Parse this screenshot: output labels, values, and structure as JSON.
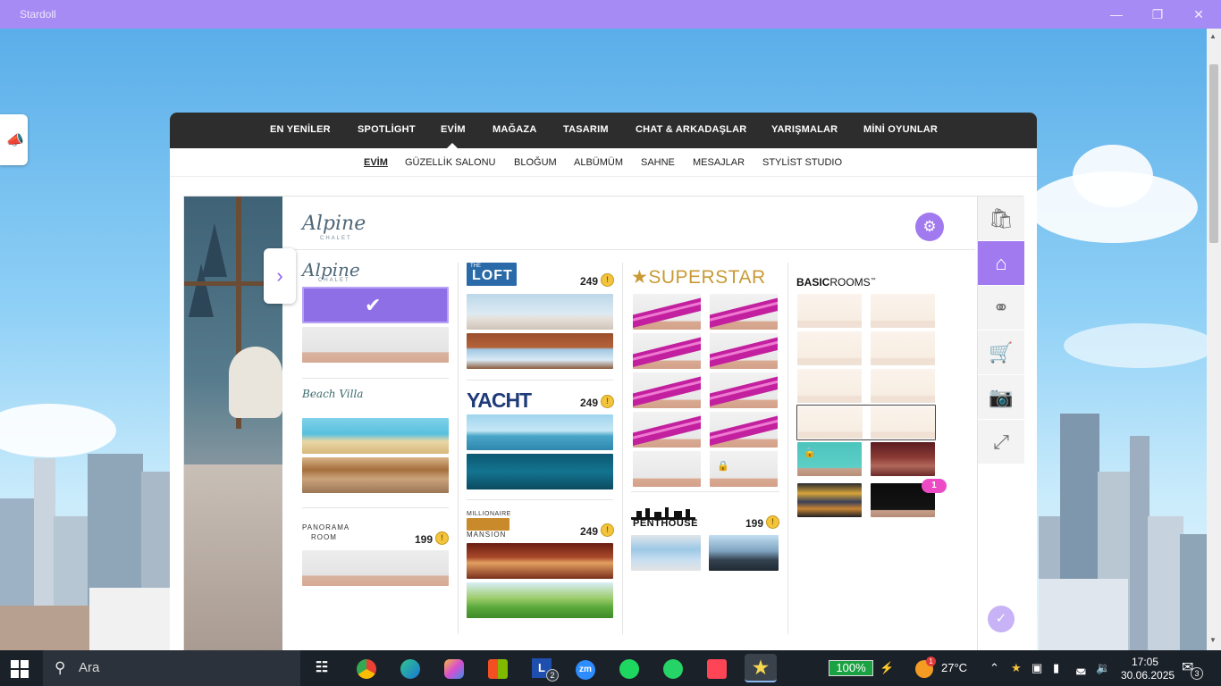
{
  "window": {
    "title": "Stardoll",
    "controls": [
      "minimize",
      "maximize",
      "close"
    ]
  },
  "top_nav": {
    "items": [
      "EN YENİLER",
      "SPOTLİGHT",
      "EVİM",
      "MAĞAZA",
      "TASARIM",
      "CHAT & ARKADAŞLAR",
      "YARIŞMALAR",
      "MİNİ OYUNLAR"
    ],
    "active": "EVİM"
  },
  "sub_nav": {
    "items": [
      "EVİM",
      "GÜZELLİK SALONU",
      "BLOĞUM",
      "ALBÜMÜM",
      "SAHNE",
      "MESAJLAR",
      "STYLİST STUDIO"
    ],
    "active": "EVİM"
  },
  "gallery": {
    "header_logo": {
      "script": "Alpine",
      "sub": "CHALET"
    },
    "alpine": {
      "script": "Alpine",
      "sub": "CHALET",
      "selected_room": 1
    },
    "beach_villa": {
      "script": "Beach Villa"
    },
    "panorama": {
      "line1": "PANORAMA",
      "line2": "ROOM",
      "price": "199"
    },
    "loft": {
      "label": "LOFT",
      "prefix": "THE",
      "price": "249"
    },
    "yacht": {
      "label": "YACHT",
      "price": "249"
    },
    "mansion": {
      "line1": "MILLIONAIRE",
      "line2": "MANSION",
      "price": "249"
    },
    "superstar": {
      "label": "SUPERSTAR"
    },
    "penthouse": {
      "label": "PENTHOUSE",
      "price": "199"
    },
    "basic": {
      "label_bold": "BASIC",
      "label_light": "ROOMS",
      "tm": "™",
      "notification": "1"
    }
  },
  "rail": {
    "buttons": [
      "shopping-bag-icon",
      "home-icon",
      "hanger-icon",
      "cart-icon",
      "camera-icon",
      "fullscreen-icon"
    ],
    "active": "home-icon"
  },
  "colors": {
    "accent": "#a27af0",
    "titlebar": "#a78bf4",
    "nav": "#2d2d2d",
    "ribbon": "#c3209f"
  },
  "taskbar": {
    "search_placeholder": "Ara",
    "apps": [
      "task-view",
      "chrome",
      "edge",
      "copilot",
      "store",
      "l-app",
      "zoom",
      "spotify",
      "whatsapp",
      "valorant",
      "stardoll"
    ],
    "l_app_badge": "2",
    "zoom_label": "zm",
    "l_app_label": "L",
    "battery": "100%",
    "weather_badge": "1",
    "temperature": "27°C",
    "time": "17:05",
    "date": "30.06.2025",
    "notifications": "3"
  }
}
